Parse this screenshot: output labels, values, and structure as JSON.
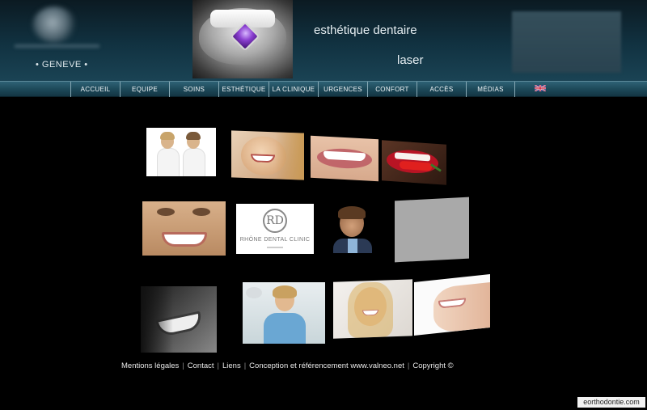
{
  "header": {
    "city": "• GENEVE •",
    "tagline_1": "esthétique dentaire",
    "tagline_2": "laser"
  },
  "nav": {
    "items": [
      {
        "label": "Accueil"
      },
      {
        "label": "Equipe"
      },
      {
        "label": "Soins"
      },
      {
        "label": "Esthétique"
      },
      {
        "label": "La clinique"
      },
      {
        "label": "Urgences"
      },
      {
        "label": "Confort"
      },
      {
        "label": "Accès"
      },
      {
        "label": "Médias"
      }
    ],
    "language_icon": "uk-flag-icon"
  },
  "gallery": {
    "clinic_logo_text": "RHÔNE DENTAL CLINIC",
    "tiles": [
      {
        "name": "team-photo"
      },
      {
        "name": "smiling-woman-photo"
      },
      {
        "name": "lips-smile-photo"
      },
      {
        "name": "red-lips-pepper-photo"
      },
      {
        "name": "woman-smile-closeup-photo"
      },
      {
        "name": "clinic-logo-tile"
      },
      {
        "name": "dentist-portrait-photo"
      },
      {
        "name": "blank-gray-tile"
      },
      {
        "name": "bw-smile-photo"
      },
      {
        "name": "assistant-photo"
      },
      {
        "name": "blonde-woman-photo"
      },
      {
        "name": "smile-profile-photo"
      }
    ]
  },
  "footer": {
    "legal": "Mentions légales",
    "contact": "Contact",
    "links": "Liens",
    "credits": "Conception et référencement www.valneo.net",
    "copyright": "Copyright ©"
  },
  "watermark": "eorthodontie.com",
  "colors": {
    "header_bg": "#113241",
    "nav_bg": "#1c4757",
    "page_bg": "#000000"
  }
}
